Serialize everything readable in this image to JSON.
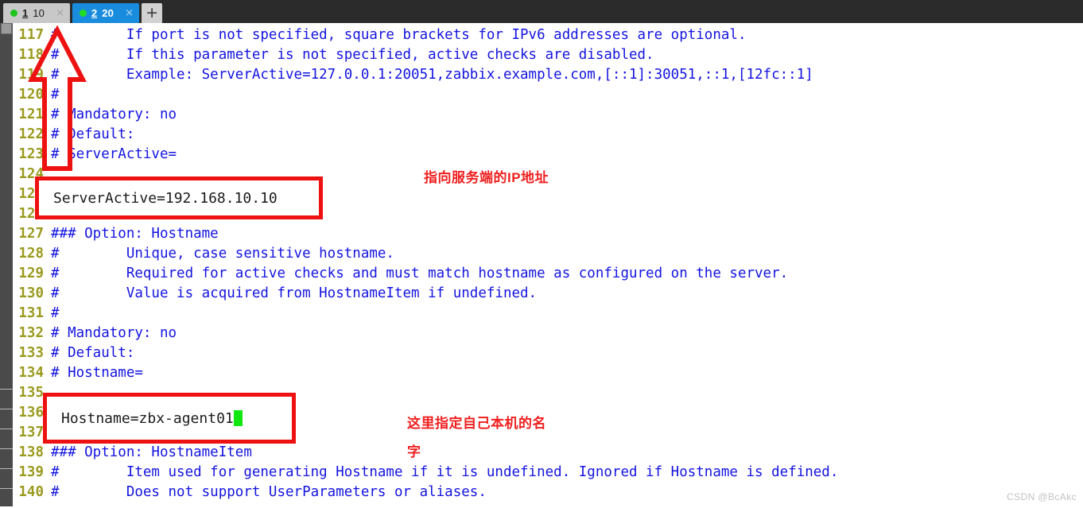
{
  "tabs": [
    {
      "dot": "green-status-dot",
      "number": "1",
      "label": "10",
      "close": "×",
      "active": false
    },
    {
      "dot": "green-status-dot",
      "number": "2",
      "label": "20",
      "close": "×",
      "active": true
    }
  ],
  "new_tab_label": "+",
  "editor": {
    "lines": [
      {
        "no": "117",
        "text": "#        If port is not specified, square brackets for IPv6 addresses are optional."
      },
      {
        "no": "118",
        "text": "#        If this parameter is not specified, active checks are disabled."
      },
      {
        "no": "119",
        "text": "#        Example: ServerActive=127.0.0.1:20051,zabbix.example.com,[::1]:30051,::1,[12fc::1]"
      },
      {
        "no": "120",
        "text": "#"
      },
      {
        "no": "121",
        "text": "# Mandatory: no"
      },
      {
        "no": "122",
        "text": "# Default:"
      },
      {
        "no": "123",
        "text": "# ServerActive="
      },
      {
        "no": "124",
        "text": ""
      },
      {
        "no": "125",
        "text": ""
      },
      {
        "no": "126",
        "text": ""
      },
      {
        "no": "127",
        "text": "### Option: Hostname"
      },
      {
        "no": "128",
        "text": "#        Unique, case sensitive hostname."
      },
      {
        "no": "129",
        "text": "#        Required for active checks and must match hostname as configured on the server."
      },
      {
        "no": "130",
        "text": "#        Value is acquired from HostnameItem if undefined."
      },
      {
        "no": "131",
        "text": "#"
      },
      {
        "no": "132",
        "text": "# Mandatory: no"
      },
      {
        "no": "133",
        "text": "# Default:"
      },
      {
        "no": "134",
        "text": "# Hostname="
      },
      {
        "no": "135",
        "text": ""
      },
      {
        "no": "136",
        "text": ""
      },
      {
        "no": "137",
        "text": ""
      },
      {
        "no": "138",
        "text": "### Option: HostnameItem"
      },
      {
        "no": "139",
        "text": "#        Item used for generating Hostname if it is undefined. Ignored if Hostname is defined."
      },
      {
        "no": "140",
        "text": "#        Does not support UserParameters or aliases."
      }
    ]
  },
  "annotations": {
    "server_active_box": "ServerActive=192.168.10.10",
    "hostname_box": "Hostname=zbx-agent01",
    "note_server_active": "指向服务端的IP地址",
    "note_hostname_line1": "这里指定自己本机的名",
    "note_hostname_line2": "字"
  },
  "watermark": "CSDN @BcAkc",
  "colors": {
    "tab_active": "#1a8cdd",
    "tab_inactive": "#c8c8c8",
    "line_number": "#9a9a1e",
    "source_text": "#1414e0",
    "annotation_red": "#ee1111",
    "cursor_green": "#10e810",
    "status_dot": "#1fc41f"
  }
}
